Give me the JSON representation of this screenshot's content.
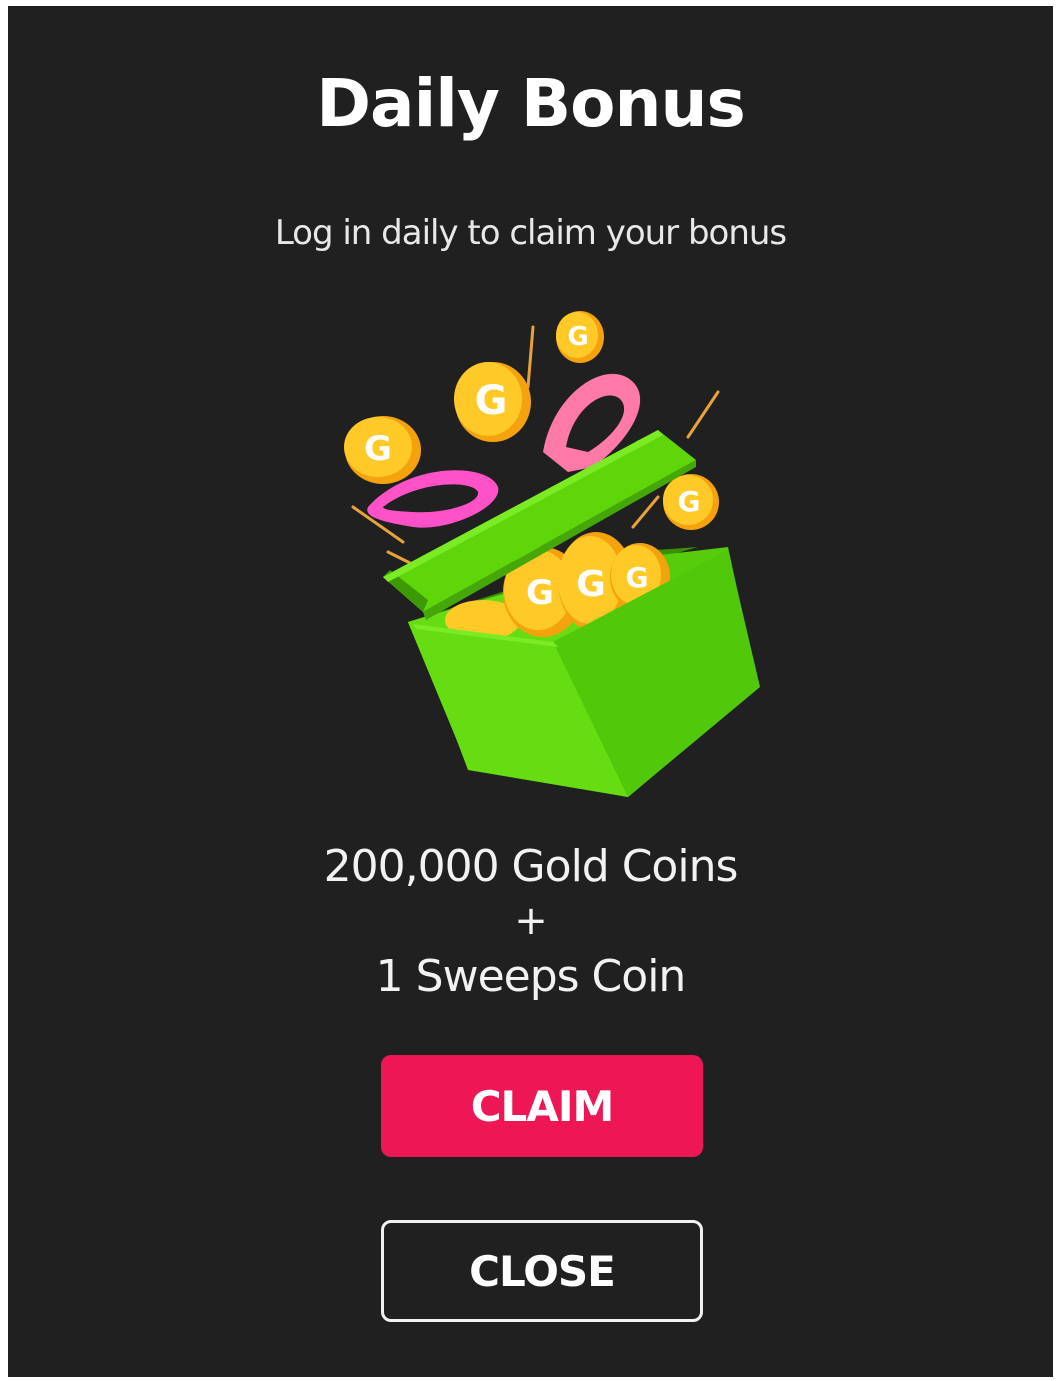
{
  "dialog": {
    "title": "Daily Bonus",
    "subtitle": "Log in daily to claim your bonus",
    "illustration_icon": "gift-box-with-coins-icon",
    "reward_gold": "200,000 Gold Coins",
    "reward_separator": "+",
    "reward_sweeps": "1 Sweeps Coin",
    "claim_label": "CLAIM",
    "close_label": "CLOSE"
  },
  "colors": {
    "background": "#202020",
    "claim_button": "#ee1755",
    "box_green": "#5ed60a",
    "coin_gold": "#ffc21a",
    "ribbon_pink": "#ff4fc8"
  }
}
